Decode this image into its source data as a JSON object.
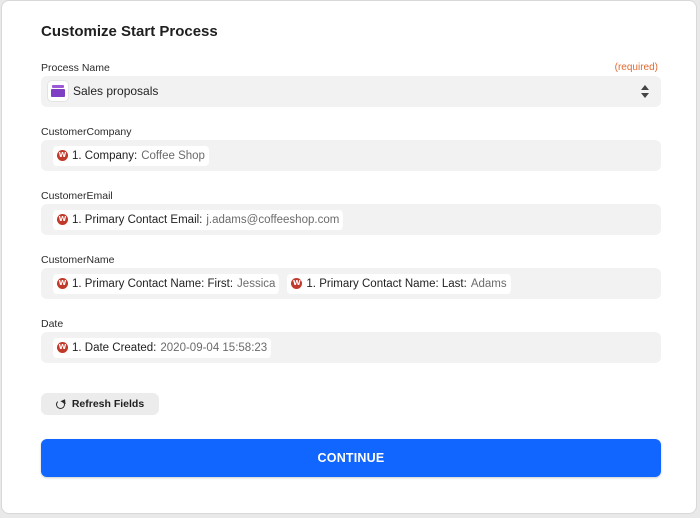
{
  "title": "Customize Start Process",
  "process_name": {
    "label": "Process Name",
    "required_text": "(required)",
    "value": "Sales proposals",
    "icon": "sales-proposals-app-icon"
  },
  "customer_company": {
    "label": "CustomerCompany",
    "pills": [
      {
        "key": "1. Company:",
        "value": "Coffee Shop"
      }
    ]
  },
  "customer_email": {
    "label": "CustomerEmail",
    "pills": [
      {
        "key": "1. Primary Contact Email:",
        "value": "j.adams@coffeeshop.com"
      }
    ]
  },
  "customer_name": {
    "label": "CustomerName",
    "pills": [
      {
        "key": "1. Primary Contact Name: First:",
        "value": "Jessica"
      },
      {
        "key": "1. Primary Contact Name: Last:",
        "value": "Adams"
      }
    ]
  },
  "date": {
    "label": "Date",
    "pills": [
      {
        "key": "1. Date Created:",
        "value": "2020-09-04 15:58:23"
      }
    ]
  },
  "refresh_label": "Refresh Fields",
  "continue_label": "CONTINUE",
  "colors": {
    "accent": "#1166ff",
    "required": "#e3692e",
    "pill_icon": "#c0392b"
  }
}
